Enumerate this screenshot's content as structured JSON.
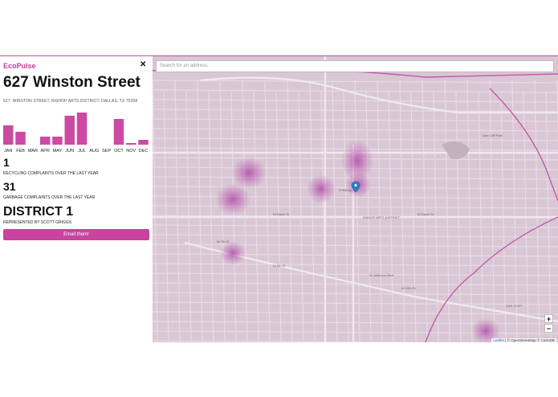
{
  "app": {
    "brand": "EcoPulse",
    "close_label": "✕"
  },
  "location": {
    "title": "627 Winston Street",
    "full_address": "627, WINSTON STREET, BISHOP ARTS DISTRICT, DALLAS, TX 75208"
  },
  "chart_data": {
    "type": "bar",
    "categories": [
      "JAN",
      "FEB",
      "MAR",
      "APR",
      "MAY",
      "JUN",
      "JUL",
      "AUG",
      "SEP",
      "OCT",
      "NOV",
      "DEC"
    ],
    "values": [
      6,
      4,
      0,
      2.5,
      2.5,
      9,
      10,
      0,
      0,
      8,
      0.5,
      1.5
    ],
    "ylim": [
      0,
      10
    ],
    "colors": {
      "bar": "#cc4aa3"
    }
  },
  "stats": {
    "recycling_count": "1",
    "recycling_label": "RECYCLING COMPLAINTS OVER THE LAST YEAR",
    "garbage_count": "31",
    "garbage_label": "GARBAGE COMPLAINTS OVER THE LAST YEAR",
    "district_name": "DISTRICT 1",
    "represented_by": "REPRESENTED BY SCOTT GRIGGS"
  },
  "actions": {
    "email_label": "Email them!"
  },
  "map": {
    "search_placeholder": "Search for an address.",
    "zoom_in": "+",
    "zoom_out": "−",
    "attribution_leaflet": "Leaflet",
    "attribution_rest": " | © OpenStreetMap © CartoDB",
    "marker_icon": "map-pin-icon",
    "street_labels": [
      "W Davis St",
      "W Davis St",
      "N Bishop Ave",
      "BISHOP ARTS DISTRICT",
      "W 7th St",
      "W 8th St",
      "W 10th St",
      "W Jefferson Blvd",
      "Lake Cliff Park",
      "OAK CLIFF"
    ]
  },
  "colors": {
    "accent": "#c9449f",
    "map_base": "#d9c7d5",
    "heat": "#b44aa8"
  }
}
